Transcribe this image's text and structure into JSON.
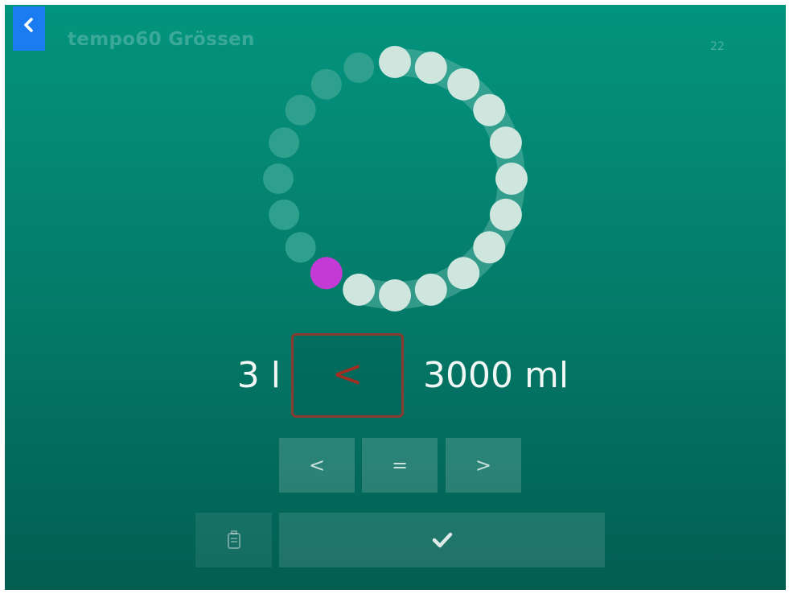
{
  "header": {
    "back_icon": "chevron-left-icon",
    "title": "tempo60 Grössen",
    "counter": "22"
  },
  "dial": {
    "total_steps": 20,
    "completed_steps": 12,
    "current_step": 13,
    "colors": {
      "completed": "#cfe6df",
      "track": "#5bb3a4",
      "pending": "#2fa08d",
      "current": "#c33ad6"
    }
  },
  "comparison": {
    "left": "3 l",
    "answer": "<",
    "right": "3000 ml",
    "answer_color": "#9e2f22"
  },
  "operators": [
    {
      "label": "<"
    },
    {
      "label": "="
    },
    {
      "label": ">"
    }
  ],
  "actions": {
    "delete_icon": "trash-icon",
    "confirm_icon": "checkmark-icon"
  },
  "colors": {
    "accent": "#1a7cf0",
    "background_top": "#03947e",
    "background_bottom": "#025e51"
  }
}
